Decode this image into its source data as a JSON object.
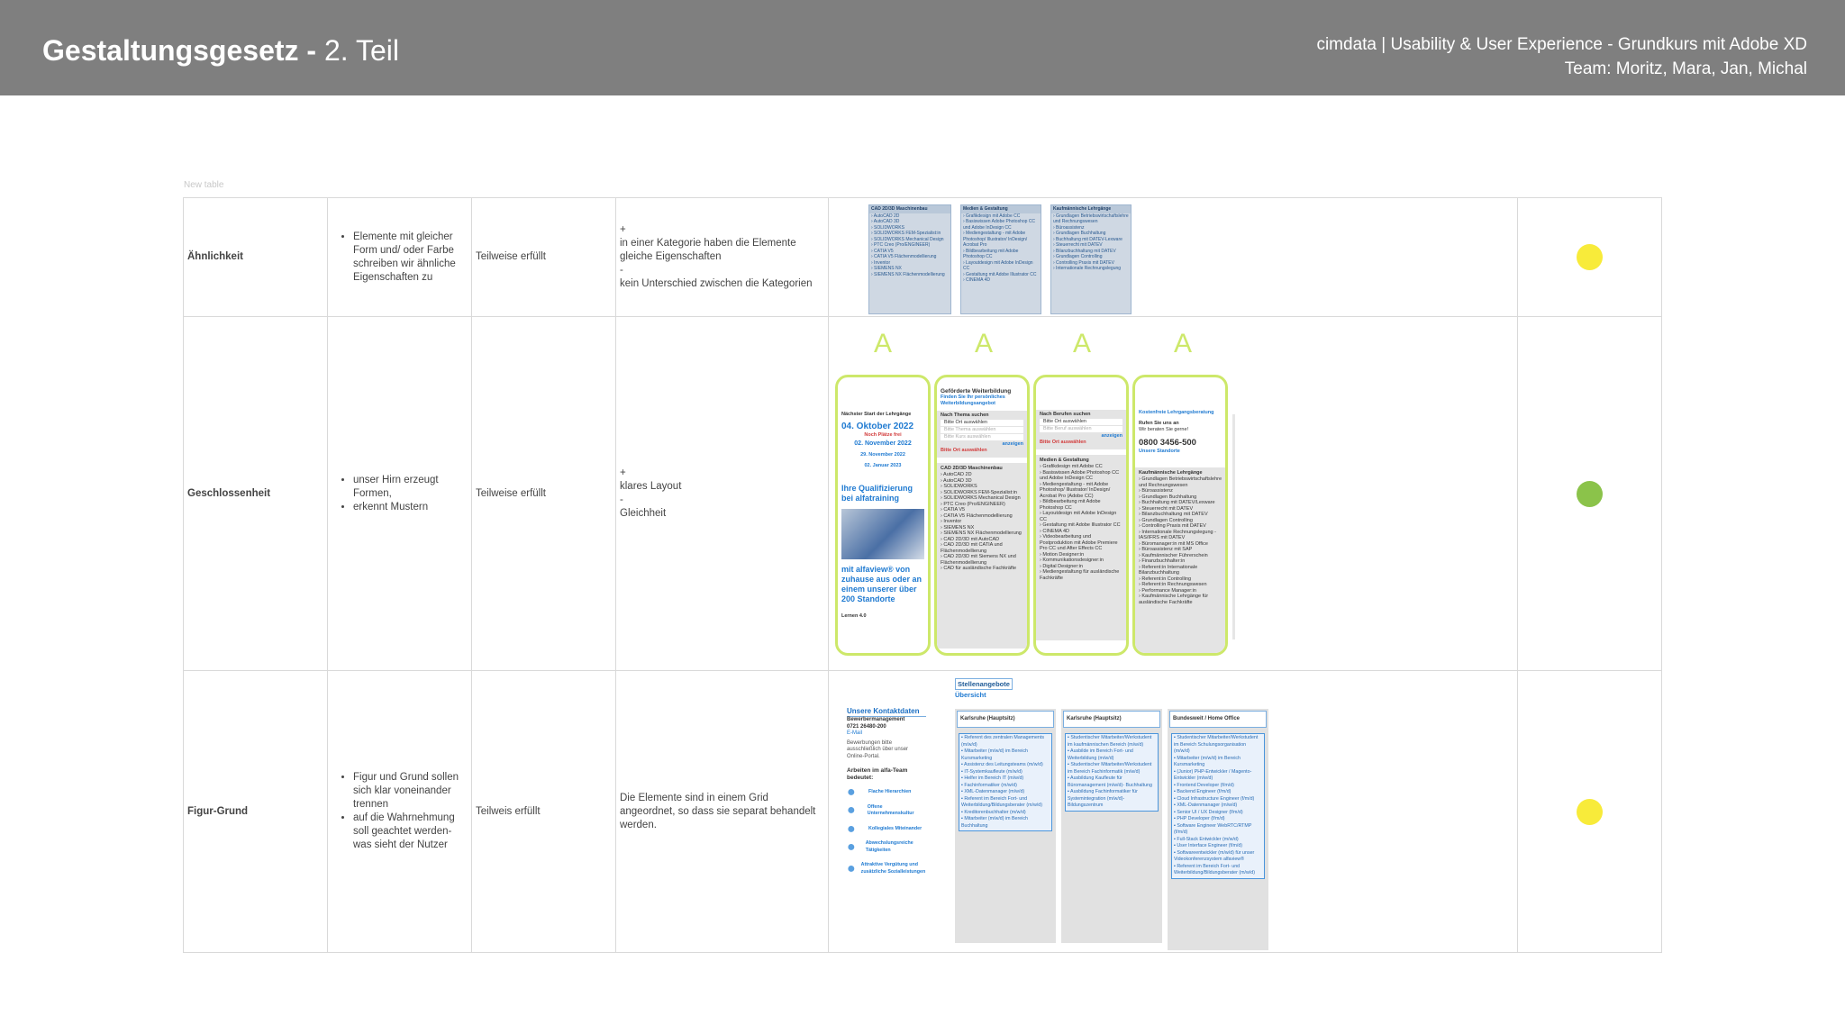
{
  "header": {
    "title_bold": "Gestaltungsgesetz -",
    "title_rest": " 2. Teil",
    "meta_line1": "cimdata | Usability & User Experience - Grundkurs mit Adobe XD",
    "meta_line2": "Team: Moritz, Mara, Jan, Michal"
  },
  "table_caption": "New table",
  "colors": {
    "yellow": "#f8eb3a",
    "green": "#8bc34a",
    "accent": "#cde86a",
    "header_bg": "#7f7f7f"
  },
  "rows": [
    {
      "name": "Ähnlichkeit",
      "desc": [
        "Elemente mit gleicher Form und/ oder Farbe schreiben wir ähnliche Eigenschaften zu"
      ],
      "status": "Teilweise erfüllt",
      "eval": "+\nin einer Kategorie haben die Elemente gleiche Eigenschaften\n-\nkein Unterschied zwischen die Kategorien",
      "dot": "yellow"
    },
    {
      "name": "Geschlossenheit",
      "desc": [
        "unser Hirn erzeugt Formen,",
        "erkennt Mustern"
      ],
      "status": "Teilweise erfüllt",
      "eval": "+\nklares Layout\n-\nGleichheit",
      "dot": "green"
    },
    {
      "name": "Figur-Grund",
      "desc": [
        "Figur und Grund sollen sich klar voneinander trennen",
        "auf die Wahrnehmung soll geachtet werden- was sieht der Nutzer"
      ],
      "status": "Teilweis erfüllt",
      "eval": "Die Elemente sind in einem Grid angeordnet, so dass sie separat behandelt werden.",
      "dot": "yellow"
    }
  ],
  "shot1": {
    "columns": [
      {
        "head": "CAD 2D/3D Maschinenbau",
        "items": [
          "AutoCAD 2D",
          "AutoCAD 3D",
          "SOLIDWORKS",
          "SOLIDWORKS FEM-Spezialist:in",
          "SOLIDWORKS Mechanical Design",
          "PTC Creo (Pro/ENGINEER)",
          "CATIA V5",
          "CATIA V5 Flächenmodellierung",
          "Inventor",
          "SIEMENS NX",
          "SIEMENS NX Flächenmodellierung"
        ]
      },
      {
        "head": "Medien & Gestaltung",
        "items": [
          "Grafikdesign mit Adobe CC",
          "Basiswissen Adobe Photoshop CC und Adobe InDesign CC",
          "Mediengestaltung - mit Adobe Photoshop/ Illustrator/ InDesign/ Acrobat Pro",
          "Bildbearbeitung mit Adobe Photoshop CC",
          "Layoutdesign mit Adobe InDesign CC",
          "Gestaltung mit Adobe Illustrator CC",
          "CINEMA 4D"
        ]
      },
      {
        "head": "Kaufmännische Lehrgänge",
        "items": [
          "Grundlagen Betriebswirtschaftslehre und Rechnungswesen",
          "Büroassistenz",
          "Grundlagen Buchhaltung",
          "Buchhaltung mit DATEV-Lexware",
          "Steuerrecht mit DATEV",
          "Bilanzbuchhaltung mit DATEV",
          "Grundlagen Controlling",
          "Controlling Praxis mit DATEV",
          "Internationale Rechnungslegung"
        ]
      }
    ]
  },
  "shot2": {
    "big_letter": "A",
    "phone1": {
      "head": "Nächster Start der Lehrgänge",
      "date_main": "04. Oktober 2022",
      "note": "Noch Plätze frei",
      "date2": "02. November 2022",
      "date3": "29. November 2022",
      "date4": "02. Januar 2023",
      "promo1": "Ihre Qualifizierung bei alfatraining",
      "promo2": "mit alfaview® von zuhause aus oder an einem unserer über 200 Standorte",
      "footer": "Lernen 4.0"
    },
    "phone2": {
      "title": "Geförderte Weiterbildung",
      "sub": "Finden Sie Ihr persönliches Weiterbildungsangebot",
      "search": "Nach Thema suchen",
      "opt1": "Bitte Ort auswählen",
      "opt2": "Bitte Thema auswählen",
      "opt3": "Bitte Kurs auswählen",
      "btn": "anzeigen",
      "warn": "Bitte Ort auswählen",
      "list_head": "CAD 2D/3D Maschinenbau",
      "items": [
        "AutoCAD 2D",
        "AutoCAD 3D",
        "SOLIDWORKS",
        "SOLIDWORKS FEM-Spezialist:in",
        "SOLIDWORKS Mechanical Design",
        "PTC Creo (Pro/ENGINEER)",
        "CATIA V5",
        "CATIA V5 Flächenmodellierung",
        "Inventor",
        "SIEMENS NX",
        "SIEMENS NX Flächenmodellierung",
        "CAD 2D/3D mit AutoCAD",
        "CAD 2D/3D mit CATIA und Flächenmodellierung",
        "CAD 2D/3D mit Siemens NX und Flächenmodellierung",
        "CAD für ausländische Fachkräfte"
      ]
    },
    "phone3": {
      "search": "Nach Berufen suchen",
      "opt1": "Bitte Ort auswählen",
      "opt2": "Bitte Beruf auswählen",
      "btn": "anzeigen",
      "warn": "Bitte Ort auswählen",
      "list_head": "Medien & Gestaltung",
      "items": [
        "Grafikdesign mit Adobe CC",
        "Basiswissen Adobe Photoshop CC und Adobe InDesign CC",
        "Mediengestaltung - mit Adobe Photoshop/ Illustrator/ InDesign/ Acrobat Pro (Adobe CC)",
        "Bildbearbeitung mit Adobe Photoshop CC",
        "Layoutdesign mit Adobe InDesign CC",
        "Gestaltung mit Adobe Illustrator CC",
        "CINEMA 4D",
        "Videobearbeitung und Postproduktion mit Adobe Premiere Pro CC und After Effects CC",
        "Motion Designer:in",
        "Kommunikationsdesigner:in",
        "Digital Designer:in",
        "Mediengestaltung für ausländische Fachkräfte"
      ]
    },
    "phone4": {
      "title": "Kostenfreie Lehrgangsberatung",
      "call": "Rufen Sie uns an",
      "advise": "Wir beraten Sie gerne!",
      "phone": "0800 3456-500",
      "link": "Unsere Standorte",
      "list_head": "Kaufmännische Lehrgänge",
      "items": [
        "Grundlagen Betriebswirtschaftslehre und Rechnungswesen",
        "Büroassistenz",
        "Grundlagen Buchhaltung",
        "Buchhaltung mit DATEV/Lexware",
        "Steuerrecht mit DATEV",
        "Bilanzbuchhaltung mit DATEV",
        "Grundlagen Controlling",
        "Controlling Praxis mit DATEV",
        "Internationale Rechnungslegung - IAS/IFRS mit DATEV",
        "Büromanager:in mit MS Office",
        "Büroassistenz mit SAP",
        "Kaufmännischer Führerschein",
        "Finanzbuchhalter:in",
        "Referent:in Internationale Bilanzbuchhaltung",
        "Referent:in Controlling",
        "Referent:in Rechnungswesen",
        "Performance Manager:in",
        "Kaufmännische Lehrgänge für ausländische Fachkräfte"
      ]
    }
  },
  "shot3": {
    "heading1": "Stellenangebote",
    "heading2": "Übersicht",
    "kontakt": {
      "title": "Unsere Kontaktdaten",
      "lines": [
        "Bewerbermanagement",
        "0721 26480-200",
        "E-Mail"
      ],
      "note": "Bewerbungen bitte ausschließlich über unser Online-Portal.",
      "benefits_title": "Arbeiten im alfa-Team bedeutet:",
      "benefits": [
        "Flache Hierarchien",
        "Offene Unternehmenskultur",
        "Kollegiales Miteinander",
        "Abwechslungsreiche Tätigkeiten",
        "Attraktive Vergütung und zusätzliche Sozialleistungen"
      ]
    },
    "columns": [
      {
        "head": "Karlsruhe (Hauptsitz)",
        "items": [
          "Referent des zentralen Managements (m/w/d)",
          "Mitarbeiter (m/w/d) im Bereich Kursmarketing",
          "Assistenz des Leitungsteams (m/w/d)",
          "IT-Systemkaufleute (m/w/d)",
          "Helfer im Bereich IT (m/w/d)",
          "Fachinformatiker (m/w/d)",
          "XML-Datenmanager (m/w/d)",
          "Referent im Bereich Fort- und Weiterbildung/Bildungsberater (m/w/d)",
          "Kreditorenbuchhalter (m/w/d)",
          "Mitarbeiter (m/w/d) im Bereich Buchhaltung"
        ]
      },
      {
        "head": "Karlsruhe (Hauptsitz)",
        "items": [
          "Studentischer Mitarbeiter/Werkstudent im kaufmännischen Bereich (m/w/d)",
          "Ausbilde im Bereich Fort- und Weiterbildung (m/w/d)",
          "Studentischer Mitarbeiter/Werkstudent im Bereich Fachinformatik (m/w/d)",
          "Ausbildung Kaufleute für Büromanagement (m/w/d)- Buchhaltung",
          "Ausbildung Fachinformatiker für Systemintegration (m/w/d)- Bildungszentrum"
        ]
      },
      {
        "head": "Bundesweit / Home Office",
        "items": [
          "Studentischer Mitarbeiter/Werkstudent im Bereich Schulungsorganisation (m/w/d)",
          "Mitarbeiter (m/w/d) im Bereich Kursmarketing",
          "(Junior) PHP-Entwickler / Magento-Entwickler (m/w/d)",
          "Frontend Developer (f/m/d)",
          "Backend Engineer (f/m/d)",
          "Cloud Infrastructure Engineer (f/m/d)",
          "XML-Datenmanager (m/w/d)",
          "Senior UI / UX Designer (f/m/d)",
          "PHP Developer (f/m/d)",
          "Software Engineer WebRTC/RTMP (f/m/d)",
          "Full-Stack Entwickler (m/w/d)",
          "User Interface Engineer (f/m/d)",
          "Softwareentwickler (m/w/d) für unser Videokonferenzsystem alfaview®",
          "Referent im Bereich Fort- und Weiterbildung/Bildungsberater (m/w/d)"
        ]
      }
    ]
  }
}
